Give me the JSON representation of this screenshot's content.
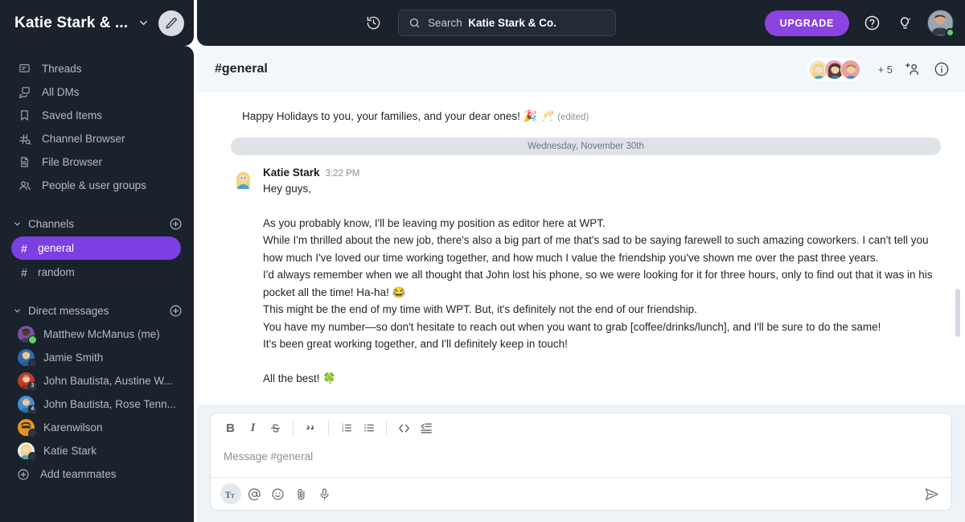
{
  "workspace": {
    "name": "Katie Stark & ...",
    "caret_icon": "chevron-down-icon",
    "compose_icon": "pencil-icon"
  },
  "topbar": {
    "history_icon": "history-clock-icon",
    "search": {
      "icon": "search-icon",
      "label": "Search",
      "scope": "Katie Stark & Co."
    },
    "upgrade_label": "UPGRADE",
    "help_icon": "question-circle-icon",
    "whats_new_icon": "lightbulb-sparkle-icon",
    "avatar_name": "user-avatar",
    "presence": "online"
  },
  "sidebar": {
    "nav": [
      {
        "label": "Threads",
        "icon": "threads-icon"
      },
      {
        "label": "All DMs",
        "icon": "all-dms-icon"
      },
      {
        "label": "Saved Items",
        "icon": "bookmark-icon"
      },
      {
        "label": "Channel Browser",
        "icon": "channel-search-icon"
      },
      {
        "label": "File Browser",
        "icon": "file-search-icon"
      },
      {
        "label": "People & user groups",
        "icon": "people-icon"
      }
    ],
    "channels_section": {
      "label": "Channels",
      "chevron_icon": "chevron-down-icon",
      "add_icon": "plus-circle-icon"
    },
    "channels": [
      {
        "label": "general",
        "active": true
      },
      {
        "label": "random",
        "active": false
      }
    ],
    "dm_section": {
      "label": "Direct messages",
      "chevron_icon": "chevron-down-icon",
      "add_icon": "plus-circle-icon"
    },
    "dms": [
      {
        "label": "Matthew McManus (me)",
        "badge": "online",
        "skin": "#4a3b33",
        "hair": "#2e2117",
        "shirt": "#7b4fa3"
      },
      {
        "label": "Jamie Smith",
        "badge": "ring",
        "skin": "#f0c8a0",
        "hair": "#e8c84a",
        "shirt": "#2b6cb0"
      },
      {
        "label": "John Bautista, Austine W...",
        "badge": "3",
        "skin": "#f0c8a0",
        "hair": "#a8784a",
        "shirt": "#c0392b"
      },
      {
        "label": "John Bautista, Rose Tenn...",
        "badge": "4",
        "skin": "#f0c8a0",
        "hair": "#c2a276",
        "shirt": "#3f8fd4"
      },
      {
        "label": "Karenwilson",
        "badge": "ring",
        "skin": "#e8921e",
        "hair": "#2b2b2b",
        "shirt": "#b5700f"
      },
      {
        "label": "Katie Stark",
        "badge": "ring",
        "skin": "#f5d8bd",
        "hair": "#efd37f",
        "shirt": "#4aa3c9"
      }
    ],
    "add_teammates": {
      "label": "Add teammates",
      "icon": "plus-circle-icon"
    }
  },
  "channel_header": {
    "title": "#general",
    "member_count_label": "+ 5",
    "add_member_icon": "add-person-icon",
    "info_icon": "info-circle-icon"
  },
  "messages": {
    "previous_line": "Happy Holidays to you, your families, and your dear ones!",
    "previous_emojis": "🎉 🥂",
    "edited_label": "(edited)",
    "date_divider": "Wednesday, November 30th",
    "message": {
      "author": "Katie Stark",
      "time": "3:22 PM",
      "lines": [
        "Hey guys,",
        "",
        "As you probably know, I'll be leaving my position as editor here at WPT.",
        "While I'm thrilled about the new job, there's also a big part of me that's sad to be saying farewell to such amazing coworkers. I can't tell you how much I've loved our time working together, and how much I value the friendship you've shown me over the past three years.",
        "I'd always remember when we all thought that John lost his phone, so we were looking for it for three hours, only to find out that it was in his pocket all the time! Ha-ha! 😂",
        "This might be the end of my time with WPT. But, it's definitely not the end of our friendship.",
        "You have my number—so don't hesitate to reach out when you want to grab [coffee/drinks/lunch], and I'll be sure to do the same!",
        "It's been great working together, and I'll definitely keep in touch!",
        "",
        "All the best! 🍀"
      ]
    }
  },
  "composer": {
    "placeholder": "Message #general",
    "format_buttons": [
      {
        "name": "bold-button",
        "glyph": "B"
      },
      {
        "name": "italic-button",
        "glyph": "I"
      },
      {
        "name": "strikethrough-button",
        "glyph": "S"
      },
      {
        "name": "blockquote-button",
        "glyph": "””"
      },
      {
        "name": "ordered-list-button",
        "glyph": "list"
      },
      {
        "name": "bulleted-list-button",
        "glyph": "list"
      },
      {
        "name": "code-button",
        "glyph": "<>"
      },
      {
        "name": "code-block-button",
        "glyph": "block"
      }
    ],
    "foot_buttons": [
      {
        "name": "formatting-toggle-button",
        "glyph": "Tt",
        "selected": true
      },
      {
        "name": "mention-button",
        "glyph": "@",
        "selected": false
      },
      {
        "name": "emoji-button",
        "glyph": "☺",
        "selected": false
      },
      {
        "name": "attach-file-button",
        "glyph": "clip",
        "selected": false
      },
      {
        "name": "audio-clip-button",
        "glyph": "mic",
        "selected": false
      }
    ],
    "send_icon": "send-paper-plane-icon"
  },
  "colors": {
    "sidebar_bg": "#1a222c",
    "accent_purple": "#7b3fe4",
    "upgrade_purple": "#8b44e0",
    "header_bg": "#f4f7fa",
    "composer_bg": "#eef3f8",
    "online_green": "#5fd35f"
  }
}
